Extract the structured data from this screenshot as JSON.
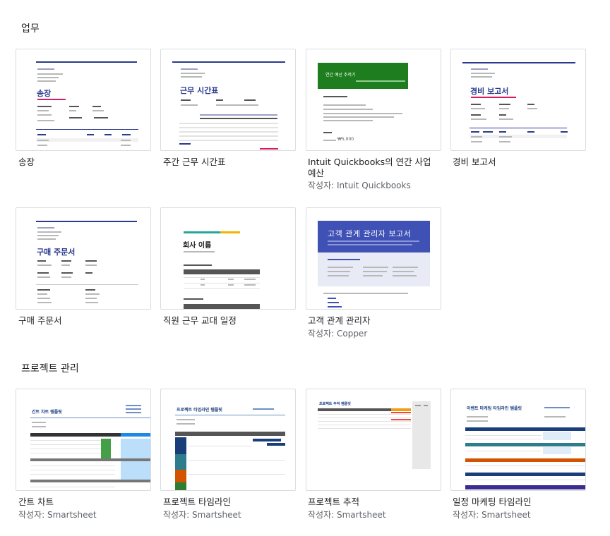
{
  "sections": {
    "work": {
      "title": "업무"
    },
    "project": {
      "title": "프로젝트 관리"
    }
  },
  "cards": {
    "invoice": {
      "name": "송장",
      "thumb_title": "송장"
    },
    "timesheet": {
      "name": "주간 근무 시간표",
      "thumb_title": "근무 시간표"
    },
    "budget": {
      "name": "Intuit Quickbooks의 연간 사업 예산",
      "author": "작성자: Intuit Quickbooks",
      "thumb_title": "연간 예산 추적기",
      "thumb_amount": "₩5,000"
    },
    "expense": {
      "name": "경비 보고서",
      "thumb_title": "경비 보고서"
    },
    "purchase": {
      "name": "구매 주문서",
      "thumb_title": "구매 주문서"
    },
    "shift": {
      "name": "직원 근무 교대 일정",
      "thumb_title": "회사 이름"
    },
    "crm": {
      "name": "고객 관계 관리자",
      "author": "작성자: Copper",
      "thumb_title": "고객 관계 관리자 보고서"
    },
    "gantt": {
      "name": "간트 차트",
      "author": "작성자: Smartsheet",
      "thumb_title": "간트 차트 템플릿"
    },
    "timeline": {
      "name": "프로젝트 타임라인",
      "author": "작성자: Smartsheet",
      "thumb_title": "프로젝트 타임라인 템플릿"
    },
    "tracker": {
      "name": "프로젝트 추적",
      "author": "작성자: Smartsheet",
      "thumb_title": "프로젝트 추적 템플릿"
    },
    "marketing": {
      "name": "일정 마케팅 타임라인",
      "author": "작성자: Smartsheet",
      "thumb_title": "이벤트 마케팅 타임라인 템플릿"
    }
  },
  "colors": {
    "navy": "#2b3a8f",
    "green": "#1e7d1e",
    "crm_blue": "#3f51b5",
    "magenta": "#d81b60"
  }
}
